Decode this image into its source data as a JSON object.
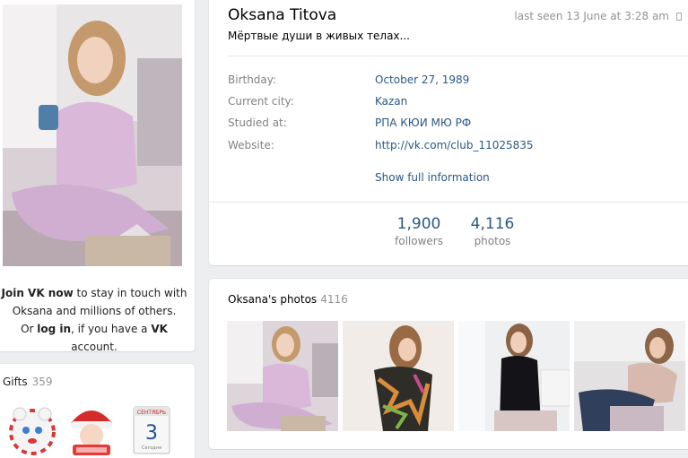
{
  "left": {
    "join_link": "Join VK now",
    "join_text1": " to stay in touch with",
    "join_text2": "Oksana and millions of others.",
    "join_text3a": "Or ",
    "login_link": "log in",
    "join_text3b": ", if you have a ",
    "vk_brand": "VK",
    "join_text3c": " account."
  },
  "gifts": {
    "title": "Gifts",
    "count": "359",
    "calendar_month": "СЕНТЯБРЬ",
    "calendar_day": "3",
    "calendar_caption": "Сегодня"
  },
  "profile": {
    "name": "Oksana Titova",
    "last_seen": "last seen 13 June at 3:28 am",
    "status": "Мёртвые души в живых телах...",
    "info": [
      {
        "label": "Birthday:",
        "value": "October 27, 1989"
      },
      {
        "label": "Current city:",
        "value": "Kazan"
      },
      {
        "label": "Studied at:",
        "value": "РПА КЮИ МЮ РФ"
      },
      {
        "label": "Website:",
        "value": "http://vk.com/club_11025835"
      }
    ],
    "show_full": "Show full information",
    "counters": [
      {
        "num": "1,900",
        "label": "followers"
      },
      {
        "num": "4,116",
        "label": "photos"
      }
    ]
  },
  "photos": {
    "title": "Oksana's photos",
    "count": "4116"
  },
  "colors": {
    "link": "#2a5885",
    "muted": "#828282",
    "background": "#edeef0"
  }
}
